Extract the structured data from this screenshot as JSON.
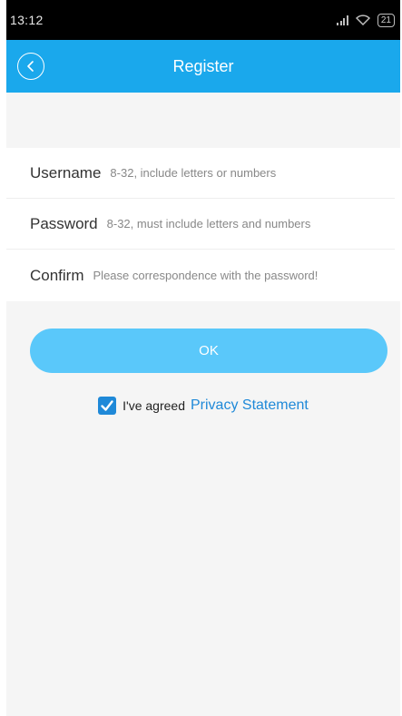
{
  "status_bar": {
    "time": "13:12",
    "battery": "21"
  },
  "header": {
    "title": "Register",
    "back_icon": "chevron-left-icon"
  },
  "form": {
    "fields": [
      {
        "label": "Username",
        "placeholder": "8-32, include letters or numbers",
        "value": ""
      },
      {
        "label": "Password",
        "placeholder": "8-32, must include letters and numbers",
        "value": ""
      },
      {
        "label": "Confirm",
        "placeholder": "Please correspondence with the password!",
        "value": ""
      }
    ]
  },
  "ok_button": {
    "label": "OK"
  },
  "agreement": {
    "checked": true,
    "text": "I've agreed",
    "link": "Privacy Statement"
  },
  "colors": {
    "header": "#1aa8ec",
    "ok_button": "#5ac8fa",
    "link": "#1f89d8",
    "background": "#f5f5f5"
  }
}
